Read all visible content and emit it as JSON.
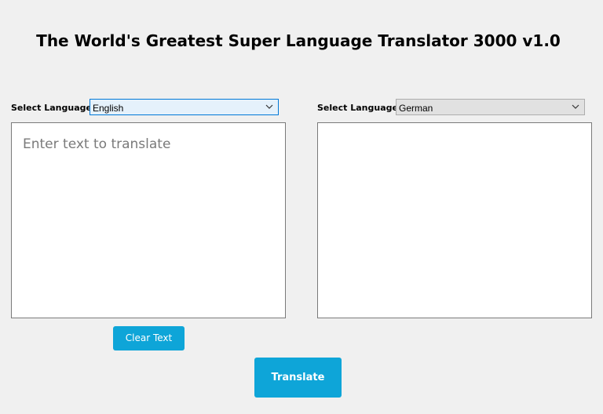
{
  "app": {
    "title": "The World's Greatest Super Language Translator 3000 v1.0"
  },
  "source": {
    "label": "Select Language:",
    "selected_language": "English",
    "placeholder": "Enter text to translate",
    "text": ""
  },
  "target": {
    "label": "Select Language:",
    "selected_language": "German",
    "text": ""
  },
  "buttons": {
    "clear_label": "Clear Text",
    "translate_label": "Translate"
  },
  "colors": {
    "window_background": "#f0f0f0",
    "button_accent": "#0ea5d8",
    "focused_select_border": "#0078d7",
    "focused_select_background": "#e5f1fb"
  },
  "icons": {
    "dropdown": "chevron-down-icon"
  }
}
